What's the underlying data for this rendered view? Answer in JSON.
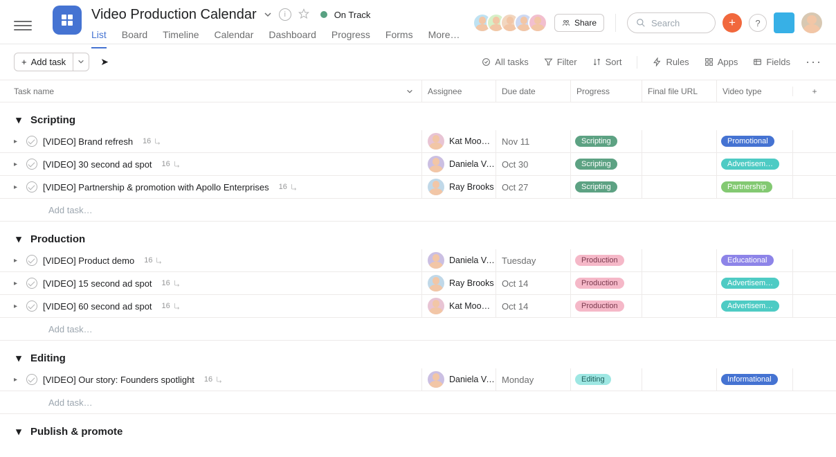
{
  "project": {
    "title": "Video Production Calendar",
    "status_label": "On Track",
    "status_color": "#58a182"
  },
  "tabs": [
    "List",
    "Board",
    "Timeline",
    "Calendar",
    "Dashboard",
    "Progress",
    "Forms",
    "More…"
  ],
  "active_tab_index": 0,
  "topbar": {
    "share_label": "Share",
    "search_placeholder": "Search"
  },
  "toolbar": {
    "add_task_label": "Add task",
    "right": {
      "all_tasks": "All tasks",
      "filter": "Filter",
      "sort": "Sort",
      "rules": "Rules",
      "apps": "Apps",
      "fields": "Fields"
    }
  },
  "columns": {
    "task": "Task name",
    "assignee": "Assignee",
    "due": "Due date",
    "progress": "Progress",
    "file": "Final file URL",
    "type": "Video type"
  },
  "add_task_placeholder": "Add task…",
  "sections": [
    {
      "name": "Scripting",
      "rows": [
        {
          "title": "[VIDEO] Brand refresh",
          "subtasks": 16,
          "assignee": "Kat Mooney",
          "avatar_bg": "#e8c4d4",
          "due": "Nov 11",
          "progress": {
            "label": "Scripting",
            "bg": "#5da283",
            "fg": "#fff"
          },
          "type": {
            "label": "Promotional",
            "bg": "#4573d2",
            "fg": "#fff"
          }
        },
        {
          "title": "[VIDEO] 30 second ad spot",
          "subtasks": 16,
          "assignee": "Daniela Var…",
          "avatar_bg": "#cbbfe2",
          "due": "Oct 30",
          "progress": {
            "label": "Scripting",
            "bg": "#5da283",
            "fg": "#fff"
          },
          "type": {
            "label": "Advertisem…",
            "bg": "#4ecbc4",
            "fg": "#fff"
          }
        },
        {
          "title": "[VIDEO] Partnership & promotion with Apollo Enterprises",
          "subtasks": 16,
          "assignee": "Ray Brooks",
          "avatar_bg": "#c0d8e8",
          "due": "Oct 27",
          "progress": {
            "label": "Scripting",
            "bg": "#5da283",
            "fg": "#fff"
          },
          "type": {
            "label": "Partnership",
            "bg": "#83c972",
            "fg": "#fff"
          }
        }
      ]
    },
    {
      "name": "Production",
      "rows": [
        {
          "title": "[VIDEO] Product demo",
          "subtasks": 16,
          "assignee": "Daniela Var…",
          "avatar_bg": "#cbbfe2",
          "due": "Tuesday",
          "progress": {
            "label": "Production",
            "bg": "#f5b8c8",
            "fg": "#7a3a4e"
          },
          "type": {
            "label": "Educational",
            "bg": "#8d84e8",
            "fg": "#fff"
          }
        },
        {
          "title": "[VIDEO] 15 second ad spot",
          "subtasks": 16,
          "assignee": "Ray Brooks",
          "avatar_bg": "#c0d8e8",
          "due": "Oct 14",
          "progress": {
            "label": "Production",
            "bg": "#f5b8c8",
            "fg": "#7a3a4e"
          },
          "type": {
            "label": "Advertisem…",
            "bg": "#4ecbc4",
            "fg": "#fff"
          }
        },
        {
          "title": "[VIDEO] 60 second ad spot",
          "subtasks": 16,
          "assignee": "Kat Mooney",
          "avatar_bg": "#e8c4d4",
          "due": "Oct 14",
          "progress": {
            "label": "Production",
            "bg": "#f5b8c8",
            "fg": "#7a3a4e"
          },
          "type": {
            "label": "Advertisem…",
            "bg": "#4ecbc4",
            "fg": "#fff"
          }
        }
      ]
    },
    {
      "name": "Editing",
      "rows": [
        {
          "title": "[VIDEO] Our story: Founders spotlight",
          "subtasks": 16,
          "assignee": "Daniela Var…",
          "avatar_bg": "#cbbfe2",
          "due": "Monday",
          "progress": {
            "label": "Editing",
            "bg": "#9ee7e3",
            "fg": "#1d5e5a"
          },
          "type": {
            "label": "Informational",
            "bg": "#4573d2",
            "fg": "#fff"
          }
        }
      ]
    },
    {
      "name": "Publish & promote",
      "rows": []
    }
  ]
}
